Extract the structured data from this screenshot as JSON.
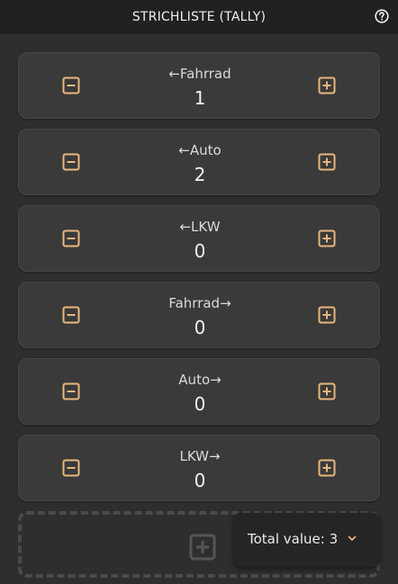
{
  "header": {
    "title": "STRICHLISTE (TALLY)",
    "help_icon": "help-circle-icon"
  },
  "colors": {
    "accent": "#e8b77d",
    "background": "#2e2e2e",
    "header": "#212121",
    "card": "#3a3a3a"
  },
  "counters": [
    {
      "label": "←Fahrrad",
      "value": "1"
    },
    {
      "label": "←Auto",
      "value": "2"
    },
    {
      "label": "←LKW",
      "value": "0"
    },
    {
      "label": "Fahrrad→",
      "value": "0"
    },
    {
      "label": "Auto→",
      "value": "0"
    },
    {
      "label": "LKW→",
      "value": "0"
    }
  ],
  "icons": {
    "decrement": "minus-square-icon",
    "increment": "plus-square-icon",
    "add_counter": "plus-square-icon"
  },
  "total": {
    "text": "Total value: 3",
    "icon": "chevron-down-icon"
  }
}
